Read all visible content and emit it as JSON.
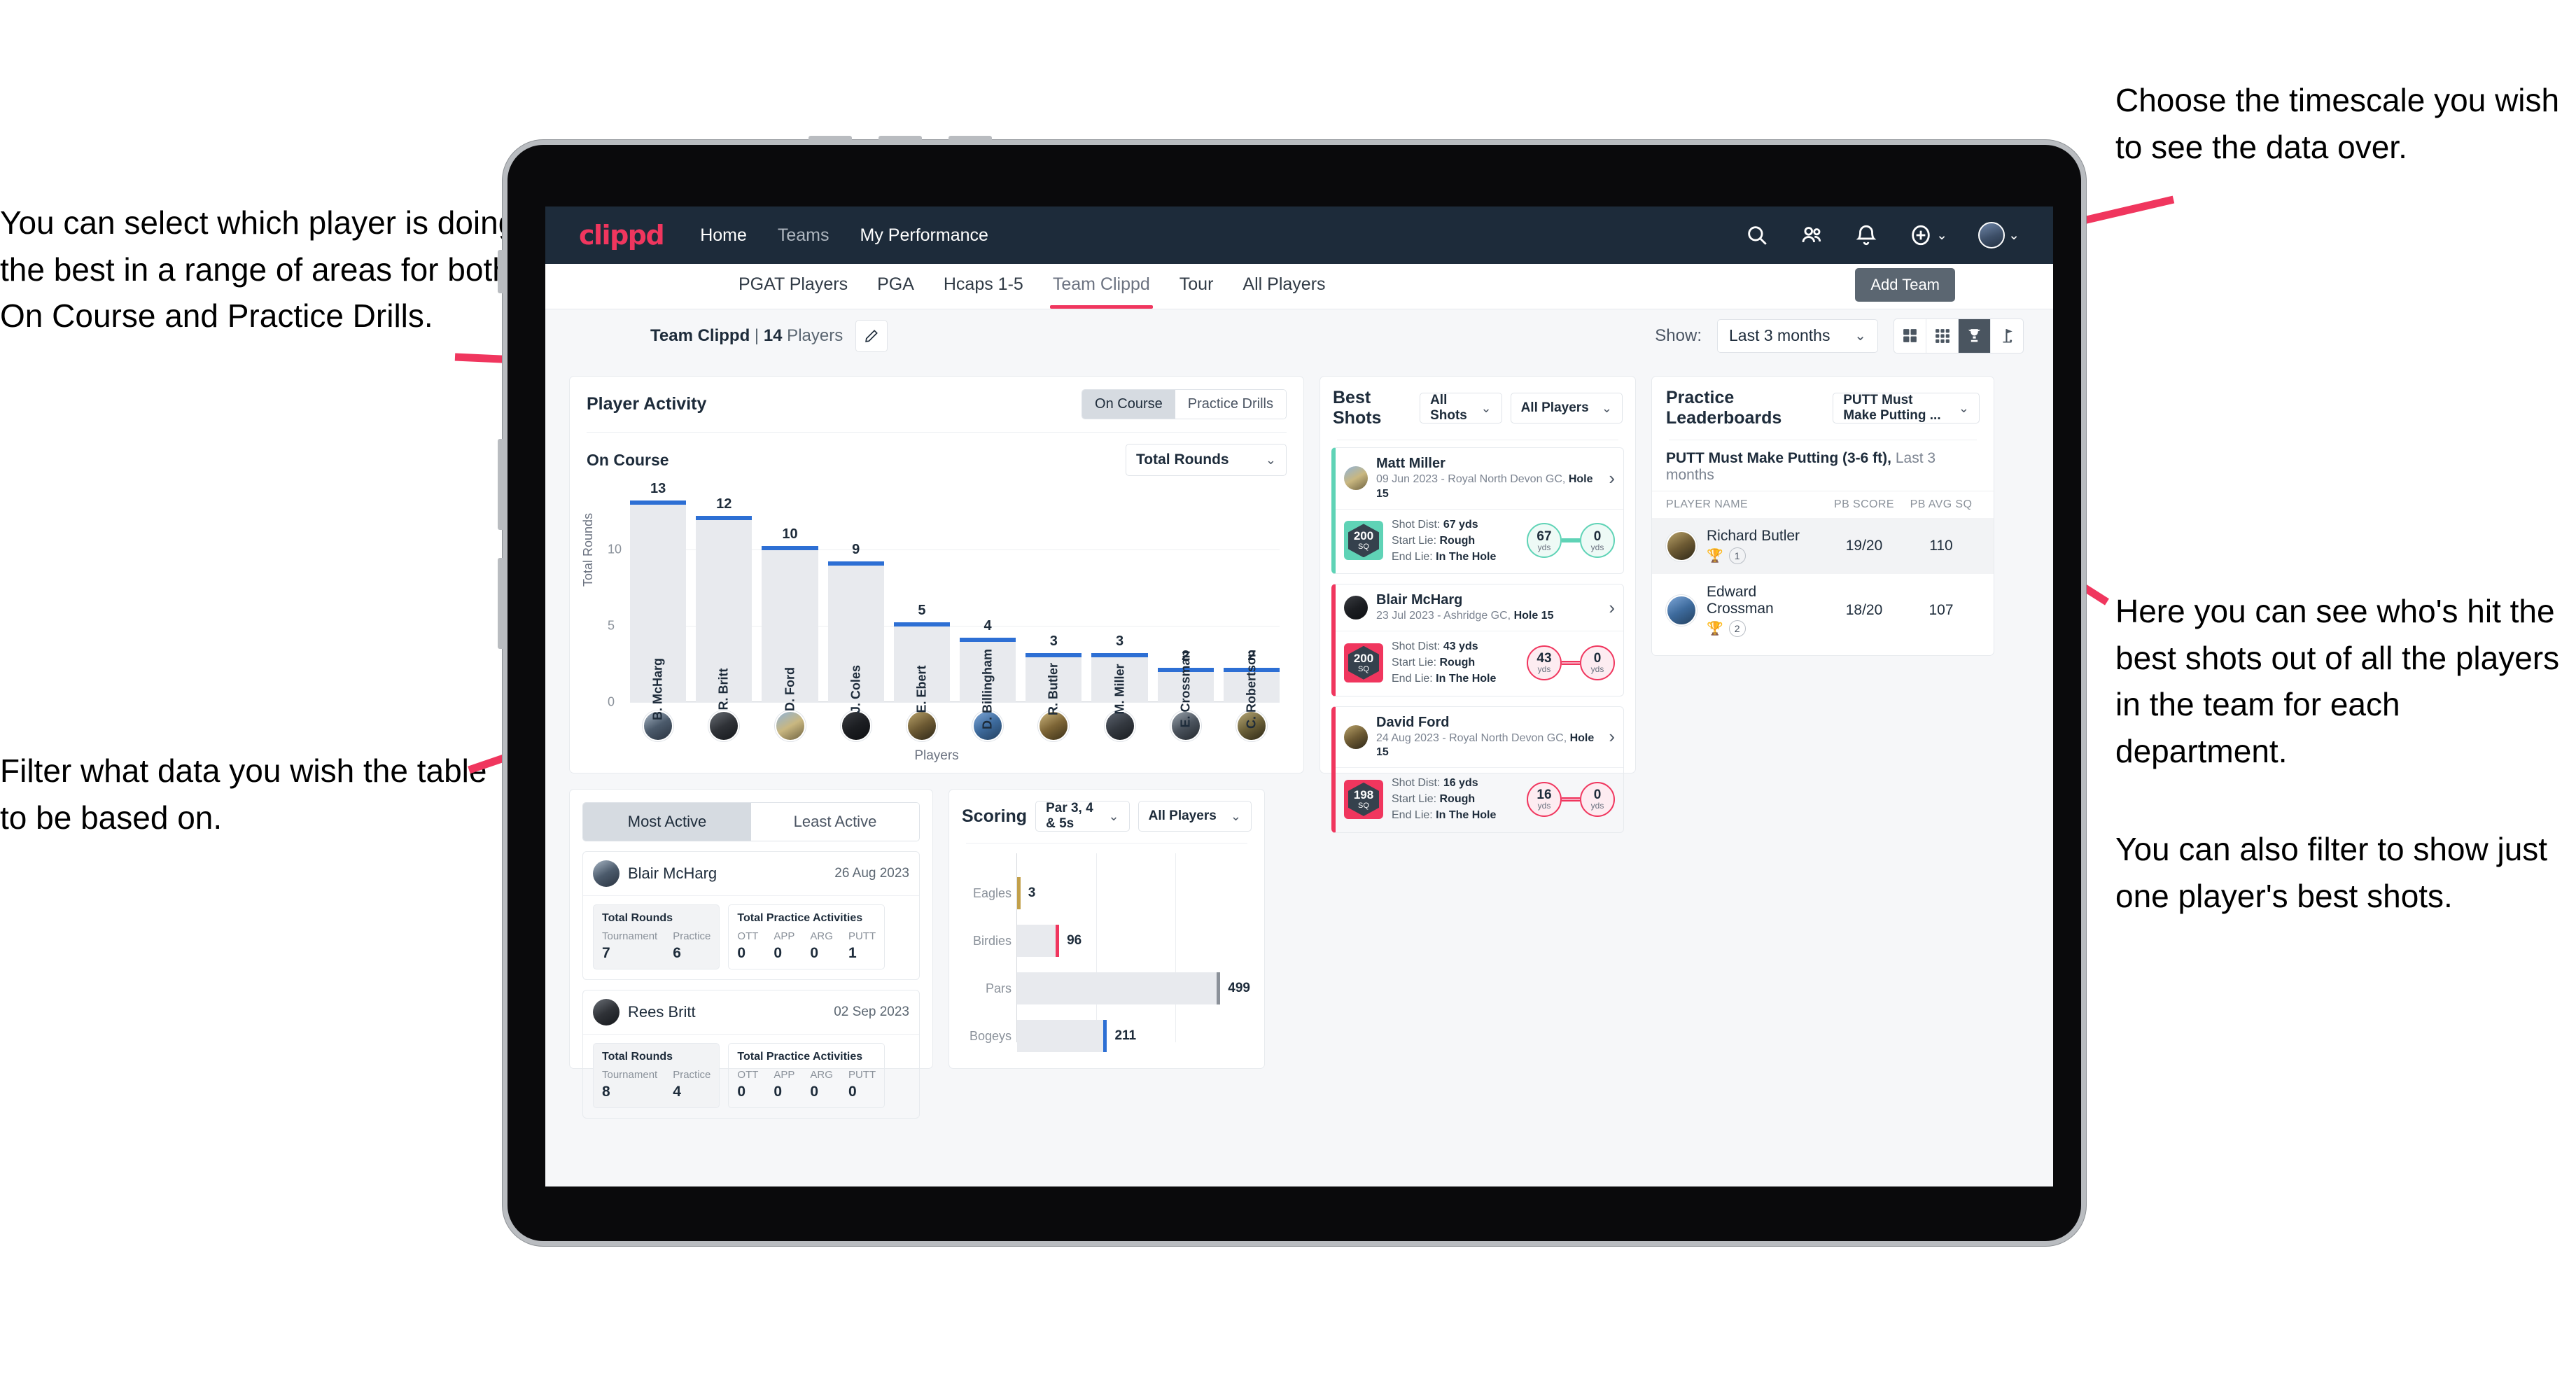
{
  "annotations": {
    "left_top": "You can select which player is doing the best in a range of areas for both On Course and Practice Drills.",
    "left_bottom": "Filter what data you wish the table to be based on.",
    "right_top": "Choose the timescale you wish to see the data over.",
    "right_middle": "Here you can see who's hit the best shots out of all the players in the team for each department.",
    "right_bottom": "You can also filter to show just one player's best shots."
  },
  "topnav": {
    "brand": "clippd",
    "links": [
      {
        "label": "Home",
        "active": true
      },
      {
        "label": "Teams",
        "active": false
      },
      {
        "label": "My Performance",
        "active": true
      }
    ],
    "icons": [
      "search-icon",
      "people-icon",
      "bell-icon",
      "plus-circle-icon",
      "avatar"
    ]
  },
  "tabs": [
    {
      "label": "PGAT Players",
      "active": false
    },
    {
      "label": "PGA",
      "active": false
    },
    {
      "label": "Hcaps 1-5",
      "active": false
    },
    {
      "label": "Team Clippd",
      "active": true
    },
    {
      "label": "Tour",
      "active": false
    },
    {
      "label": "All Players",
      "active": false
    }
  ],
  "tooltip": {
    "add_team": "Add Team"
  },
  "subbar": {
    "team_name": "Team Clippd",
    "separator": " | ",
    "player_count": "14",
    "players_word": " Players",
    "edit_icon": "pencil-icon",
    "show_label": "Show:",
    "period_value": "Last 3 months",
    "view_modes": [
      "grid-2x2-icon",
      "grid-3x3-icon",
      "trophy-icon",
      "flag-icon"
    ],
    "active_view": "trophy-icon"
  },
  "player_activity": {
    "title": "Player Activity",
    "segments": [
      {
        "label": "On Course",
        "active": true
      },
      {
        "label": "Practice Drills",
        "active": false
      }
    ],
    "sub_label": "On Course",
    "metric_value": "Total Rounds",
    "chart_data": {
      "type": "bar",
      "title": "Player Activity - On Course",
      "categories": [
        "B. McHarg",
        "R. Britt",
        "D. Ford",
        "J. Coles",
        "E. Ebert",
        "D. Billingham",
        "R. Butler",
        "M. Miller",
        "E. Crossman",
        "C. Robertson"
      ],
      "values": [
        13,
        12,
        10,
        9,
        5,
        4,
        3,
        3,
        2,
        2
      ],
      "xlabel": "Players",
      "ylabel": "Total Rounds",
      "yticks": [
        0,
        5,
        10
      ],
      "ylim": [
        0,
        14
      ],
      "grid": true,
      "bar_color": "#e8eaee",
      "cap_color": "#2d6fd4"
    }
  },
  "best_shots": {
    "title": "Best Shots",
    "shot_filter": "All Shots",
    "player_filter": "All Players",
    "cards": [
      {
        "name": "Matt Miller",
        "meta_date": "09 Jun 2023",
        "meta_course": " - Royal North Devon GC, ",
        "meta_hole": "Hole 15",
        "score": "200",
        "score_unit": "SQ",
        "shot_dist_label": "Shot Dist: ",
        "shot_dist": "67 yds",
        "start_lie_label": "Start Lie: ",
        "start_lie": "Rough",
        "end_lie_label": "End Lie: ",
        "end_lie": "In The Hole",
        "from_val": "67",
        "from_unit": "yds",
        "to_val": "0",
        "to_unit": "yds",
        "accent": "teal"
      },
      {
        "name": "Blair McHarg",
        "meta_date": "23 Jul 2023",
        "meta_course": " - Ashridge GC, ",
        "meta_hole": "Hole 15",
        "score": "200",
        "score_unit": "SQ",
        "shot_dist_label": "Shot Dist: ",
        "shot_dist": "43 yds",
        "start_lie_label": "Start Lie: ",
        "start_lie": "Rough",
        "end_lie_label": "End Lie: ",
        "end_lie": "In The Hole",
        "from_val": "43",
        "from_unit": "yds",
        "to_val": "0",
        "to_unit": "yds",
        "accent": "pink"
      },
      {
        "name": "David Ford",
        "meta_date": "24 Aug 2023",
        "meta_course": " - Royal North Devon GC, ",
        "meta_hole": "Hole 15",
        "score": "198",
        "score_unit": "SQ",
        "shot_dist_label": "Shot Dist: ",
        "shot_dist": "16 yds",
        "start_lie_label": "Start Lie: ",
        "start_lie": "Rough",
        "end_lie_label": "End Lie: ",
        "end_lie": "In The Hole",
        "from_val": "16",
        "from_unit": "yds",
        "to_val": "0",
        "to_unit": "yds",
        "accent": "pink"
      }
    ]
  },
  "practice_leaderboards": {
    "title": "Practice Leaderboards",
    "drill_filter": "PUTT Must Make Putting ...",
    "subtitle_bold": "PUTT Must Make Putting (3-6 ft),",
    "subtitle_light": " Last 3 months",
    "columns": [
      "PLAYER NAME",
      "PB SCORE",
      "PB AVG SQ"
    ],
    "rows": [
      {
        "name": "Richard Butler",
        "rank": "1",
        "trophy": "gold",
        "pb_score": "19/20",
        "pb_avg_sq": "110",
        "highlight": true
      },
      {
        "name": "Edward Crossman",
        "rank": "2",
        "trophy": "silver",
        "pb_score": "18/20",
        "pb_avg_sq": "107",
        "highlight": false
      }
    ]
  },
  "activity": {
    "tabs": [
      {
        "label": "Most Active",
        "active": true
      },
      {
        "label": "Least Active",
        "active": false
      }
    ],
    "cards": [
      {
        "name": "Blair McHarg",
        "date": "26 Aug 2023",
        "rounds_title": "Total Rounds",
        "rounds_cols": [
          "Tournament",
          "Practice"
        ],
        "rounds_vals": [
          "7",
          "6"
        ],
        "practice_title": "Total Practice Activities",
        "practice_cols": [
          "OTT",
          "APP",
          "ARG",
          "PUTT"
        ],
        "practice_vals": [
          "0",
          "0",
          "0",
          "1"
        ]
      },
      {
        "name": "Rees Britt",
        "date": "02 Sep 2023",
        "rounds_title": "Total Rounds",
        "rounds_cols": [
          "Tournament",
          "Practice"
        ],
        "rounds_vals": [
          "8",
          "4"
        ],
        "practice_title": "Total Practice Activities",
        "practice_cols": [
          "OTT",
          "APP",
          "ARG",
          "PUTT"
        ],
        "practice_vals": [
          "0",
          "0",
          "0",
          "0"
        ]
      }
    ]
  },
  "scoring": {
    "title": "Scoring",
    "par_filter": "Par 3, 4 & 5s",
    "player_filter": "All Players",
    "chart_data": {
      "type": "bar",
      "orientation": "horizontal",
      "title": "Scoring",
      "categories": [
        "Eagles",
        "Birdies",
        "Pars",
        "Bogeys"
      ],
      "values": [
        3,
        96,
        499,
        211
      ],
      "xlim": [
        0,
        560
      ],
      "grid": true,
      "bar_color": "#e8eaee",
      "cap_colors": [
        "#c2a04a",
        "#f0365e",
        "#8b9199",
        "#2d6fd4"
      ]
    }
  }
}
